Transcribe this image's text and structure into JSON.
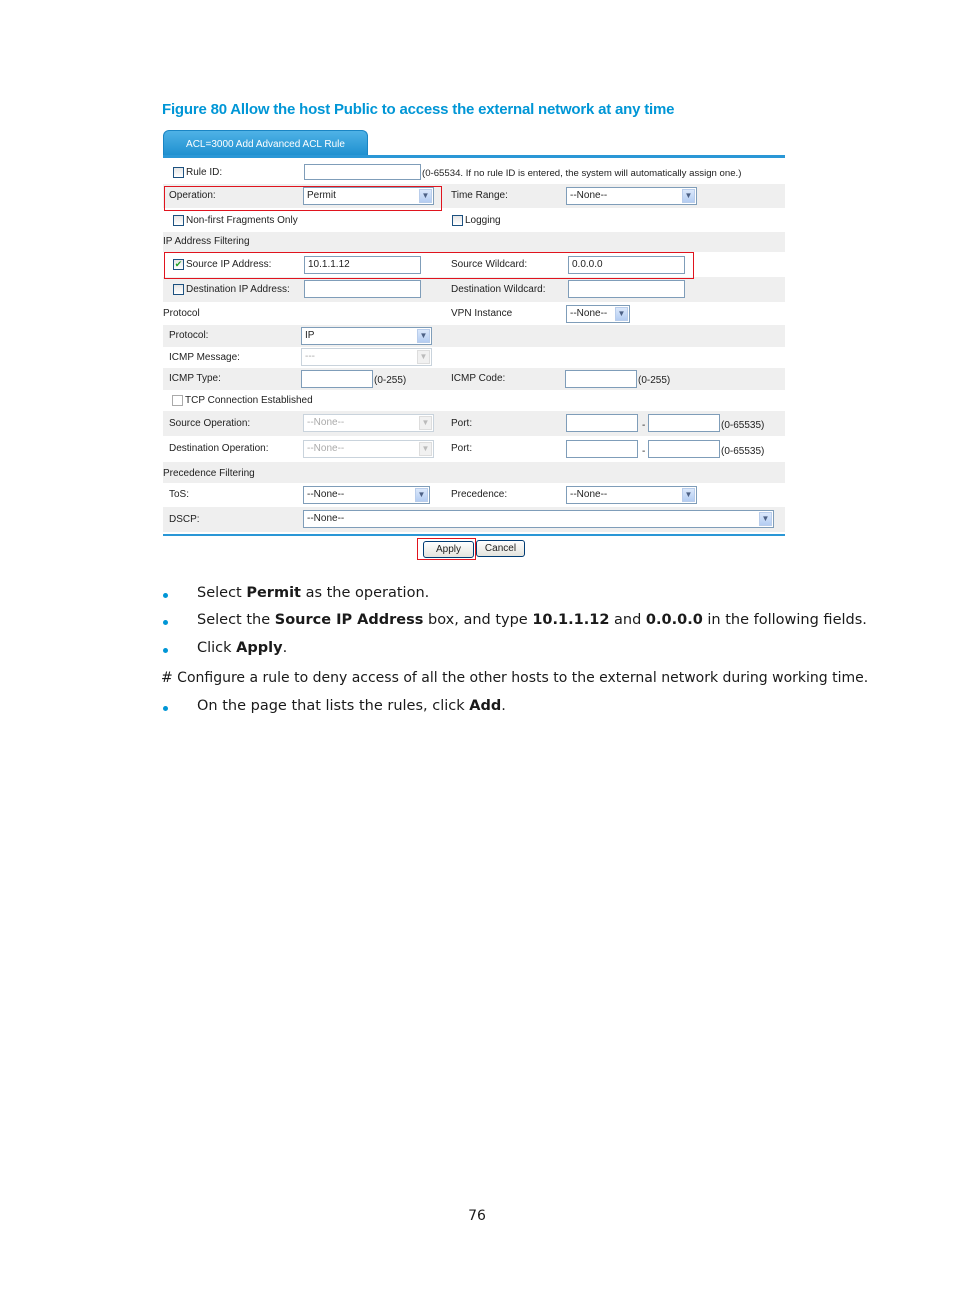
{
  "figure_title": "Figure 80 Allow the host Public to access the external network at any time",
  "form": {
    "tab_label": "ACL=3000 Add Advanced ACL Rule",
    "rule_id": {
      "label": "Rule ID:",
      "checked": false,
      "value": "",
      "hint": "(0-65534. If no rule ID is entered, the system will automatically assign one.)"
    },
    "operation": {
      "label": "Operation:",
      "value": "Permit"
    },
    "time_range": {
      "label": "Time Range:",
      "value": "--None--"
    },
    "non_first_fragments": {
      "label": "Non-first Fragments Only",
      "checked": false
    },
    "logging": {
      "label": "Logging",
      "checked": false
    },
    "section_ip": "IP Address Filtering",
    "source_ip": {
      "label": "Source IP Address:",
      "checked": true,
      "value": "10.1.1.12"
    },
    "source_wildcard": {
      "label": "Source Wildcard:",
      "value": "0.0.0.0"
    },
    "dest_ip": {
      "label": "Destination IP Address:",
      "checked": false,
      "value": ""
    },
    "dest_wildcard": {
      "label": "Destination Wildcard:",
      "value": ""
    },
    "section_protocol": "Protocol",
    "vpn_instance": {
      "label": "VPN Instance",
      "value": "--None--"
    },
    "protocol": {
      "label": "Protocol:",
      "value": "IP"
    },
    "icmp_message": {
      "label": "ICMP Message:",
      "value": "---"
    },
    "icmp_type": {
      "label": "ICMP Type:",
      "value": "",
      "hint": "(0-255)"
    },
    "icmp_code": {
      "label": "ICMP Code:",
      "value": "",
      "hint": "(0-255)"
    },
    "tcp_established": {
      "label": "TCP Connection Established",
      "checked": false
    },
    "source_operation": {
      "label": "Source Operation:",
      "value": "--None--"
    },
    "source_port": {
      "label": "Port:",
      "from": "",
      "to": "",
      "separator": "-",
      "hint": "(0-65535)"
    },
    "dest_operation": {
      "label": "Destination Operation:",
      "value": "--None--"
    },
    "dest_port": {
      "label": "Port:",
      "from": "",
      "to": "",
      "separator": "-",
      "hint": "(0-65535)"
    },
    "section_precedence": "Precedence Filtering",
    "tos": {
      "label": "ToS:",
      "value": "--None--"
    },
    "precedence": {
      "label": "Precedence:",
      "value": "--None--"
    },
    "dscp": {
      "label": "DSCP:",
      "value": "--None--"
    },
    "apply_label": "Apply",
    "cancel_label": "Cancel",
    "check_glyph": "✔",
    "arrow_glyph": "▼"
  },
  "instructions": [
    {
      "pre": "Select ",
      "b1": "Permit",
      "mid": " as the operation.",
      "b2": "",
      "mid2": "",
      "b3": "",
      "post": ""
    },
    {
      "pre": "Select the ",
      "b1": "Source IP Address",
      "mid": " box, and type ",
      "b2": "10.1.1.12",
      "mid2": " and ",
      "b3": "0.0.0.0",
      "post": " in the following fields."
    },
    {
      "pre": "Click ",
      "b1": "Apply",
      "mid": ".",
      "b2": "",
      "mid2": "",
      "b3": "",
      "post": ""
    }
  ],
  "paragraph": "# Configure a rule to deny access of all the other hosts to the external network during working time.",
  "instruction_last": {
    "pre": "On the page that lists the rules, click ",
    "b1": "Add",
    "post": "."
  },
  "page_number": "76"
}
